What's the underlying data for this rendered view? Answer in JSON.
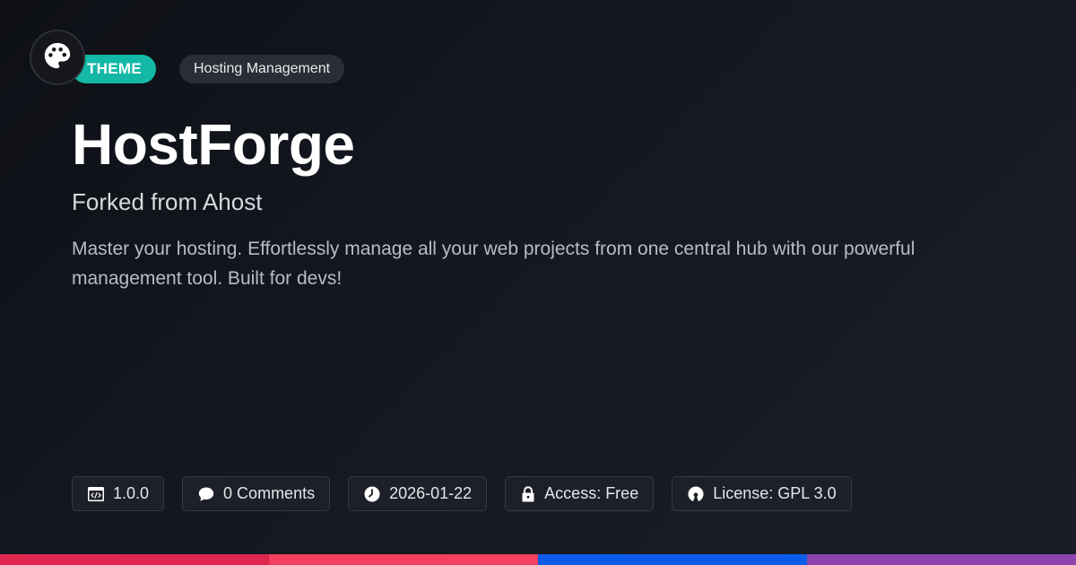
{
  "header": {
    "logo_icon": "palette-icon",
    "type_badge": "THEME",
    "category_badge": "Hosting Management"
  },
  "main": {
    "title": "HostForge",
    "subtitle": "Forked from Ahost",
    "description": "Master your hosting. Effortlessly manage all your web projects from one central hub with our powerful management tool. Built for devs!"
  },
  "meta": {
    "version": {
      "icon": "code-window-icon",
      "text": "1.0.0"
    },
    "comments": {
      "icon": "chat-bubble-icon",
      "text": "0 Comments"
    },
    "date": {
      "icon": "clock-icon",
      "text": "2026-01-22"
    },
    "access": {
      "icon": "lock-icon",
      "text": "Access: Free"
    },
    "license": {
      "icon": "open-source-icon",
      "text": "License: GPL 3.0"
    }
  },
  "colors": {
    "accent": "#14b8a6",
    "bar_1": "#e0264f",
    "bar_2": "#f43f5e",
    "bar_3": "#0a5ce8",
    "bar_4": "#8e44ad"
  }
}
